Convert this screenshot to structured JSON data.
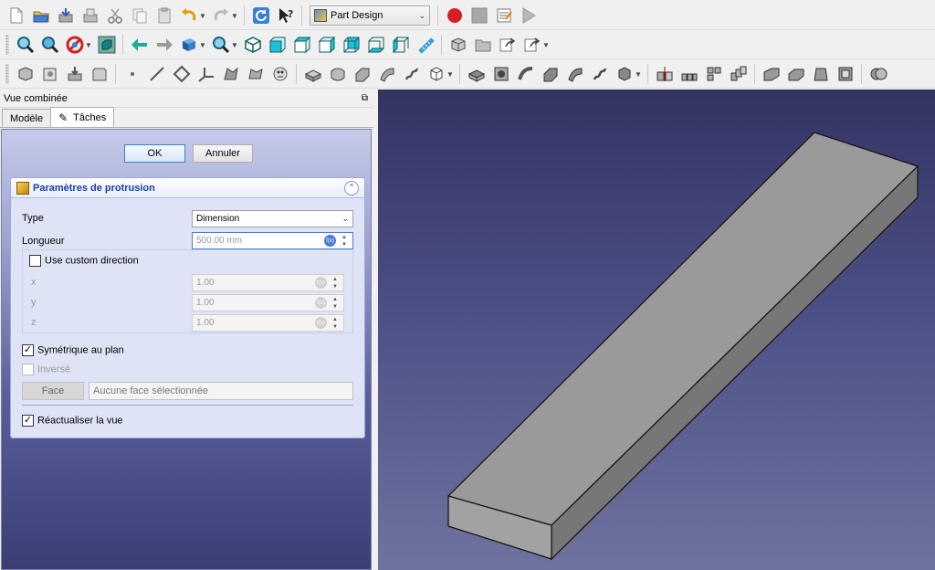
{
  "toolbar": {
    "workbench": "Part Design"
  },
  "combo": {
    "title": "Vue combinée",
    "tabs": [
      {
        "label": "Modèle"
      },
      {
        "label": "Tâches"
      }
    ],
    "ok_label": "OK",
    "cancel_label": "Annuler",
    "panel": {
      "title": "Paramètres de protrusion",
      "type_label": "Type",
      "type_value": "Dimension",
      "length_label": "Longueur",
      "length_value": "500.00 mm",
      "custom_dir_label": "Use custom direction",
      "custom_dir_checked": false,
      "x_label": "x",
      "x_value": "1.00",
      "y_label": "y",
      "y_value": "1.00",
      "z_label": "z",
      "z_value": "1.00",
      "symmetric_label": "Symétrique au plan",
      "symmetric_checked": true,
      "reversed_label": "Inversé",
      "reversed_checked": false,
      "face_button": "Face",
      "face_placeholder": "Aucune face sélectionnée",
      "refresh_label": "Réactualiser la vue",
      "refresh_checked": true
    }
  },
  "viewport": {
    "background_top": "#343463",
    "background_bottom": "#6f739f",
    "shape_color": "#9a9a9a"
  }
}
